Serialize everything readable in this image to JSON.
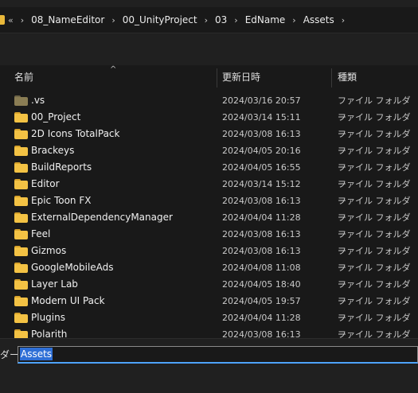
{
  "address": {
    "overflow": "«",
    "crumbs": [
      "08_NameEditor",
      "00_UnityProject",
      "03",
      "EdName",
      "Assets"
    ]
  },
  "columns": {
    "name": "名前",
    "date": "更新日時",
    "type": "種類"
  },
  "files": [
    {
      "name": ".vs",
      "date": "2024/03/16 20:57",
      "type": "ファイル フォルダー",
      "hidden": true
    },
    {
      "name": "00_Project",
      "date": "2024/03/14 15:11",
      "type": "ファイル フォルダー"
    },
    {
      "name": "2D Icons TotalPack",
      "date": "2024/03/08 16:13",
      "type": "ファイル フォルダー"
    },
    {
      "name": "Brackeys",
      "date": "2024/04/05 20:16",
      "type": "ファイル フォルダー"
    },
    {
      "name": "BuildReports",
      "date": "2024/04/05 16:55",
      "type": "ファイル フォルダー"
    },
    {
      "name": "Editor",
      "date": "2024/03/14 15:12",
      "type": "ファイル フォルダー"
    },
    {
      "name": "Epic Toon FX",
      "date": "2024/03/08 16:13",
      "type": "ファイル フォルダー"
    },
    {
      "name": "ExternalDependencyManager",
      "date": "2024/04/04 11:28",
      "type": "ファイル フォルダー"
    },
    {
      "name": "Feel",
      "date": "2024/03/08 16:13",
      "type": "ファイル フォルダー"
    },
    {
      "name": "Gizmos",
      "date": "2024/03/08 16:13",
      "type": "ファイル フォルダー"
    },
    {
      "name": "GoogleMobileAds",
      "date": "2024/04/08 11:08",
      "type": "ファイル フォルダー"
    },
    {
      "name": "Layer Lab",
      "date": "2024/04/05 18:40",
      "type": "ファイル フォルダー"
    },
    {
      "name": "Modern UI Pack",
      "date": "2024/04/05 19:57",
      "type": "ファイル フォルダー"
    },
    {
      "name": "Plugins",
      "date": "2024/04/04 11:28",
      "type": "ファイル フォルダー"
    },
    {
      "name": "Polarith",
      "date": "2024/03/08 16:13",
      "type": "ファイル フォルダー"
    }
  ],
  "footer": {
    "label": "ダー:",
    "value": "Assets"
  }
}
